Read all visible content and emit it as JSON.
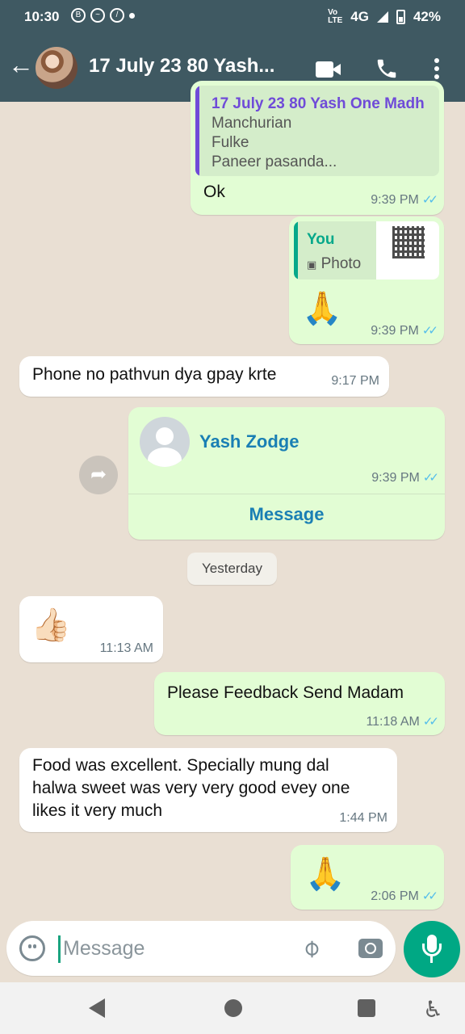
{
  "status_bar": {
    "time": "10:30",
    "network": "4G",
    "battery": "42%"
  },
  "header": {
    "contact_name": "17 July 23 80 Yash...",
    "colors": {
      "bar": "#3f5962"
    }
  },
  "messages": {
    "m1": {
      "quote_top": "17 July 23 80 Yash One Madh",
      "quote_lines": [
        "Manchurian",
        "Fulke",
        "Paneer pasanda..."
      ],
      "text": "Ok",
      "time": "9:39 PM"
    },
    "m2": {
      "quote_name": "You",
      "quote_label": "Photo",
      "emoji": "🙏",
      "time": "9:39 PM"
    },
    "m3": {
      "text": "Phone no pathvun dya gpay krte",
      "time": "9:17 PM"
    },
    "m4": {
      "contact": "Yash Zodge",
      "time": "9:39 PM",
      "action": "Message"
    },
    "date_chip": "Yesterday",
    "m5": {
      "emoji": "👍🏻",
      "time": "11:13 AM"
    },
    "m6": {
      "text": "Please Feedback Send Madam",
      "time": "11:18 AM"
    },
    "m7": {
      "text": "Food was excellent. Specially mung dal halwa sweet was very very good evey one likes it very much",
      "time": "1:44 PM"
    },
    "m8": {
      "emoji": "🙏",
      "time": "2:06 PM"
    }
  },
  "composer": {
    "placeholder": "Message"
  },
  "colors": {
    "outgoing": "#e2fdd4",
    "incoming": "#ffffff",
    "accent": "#00a884",
    "read_ticks": "#53bdeb"
  }
}
